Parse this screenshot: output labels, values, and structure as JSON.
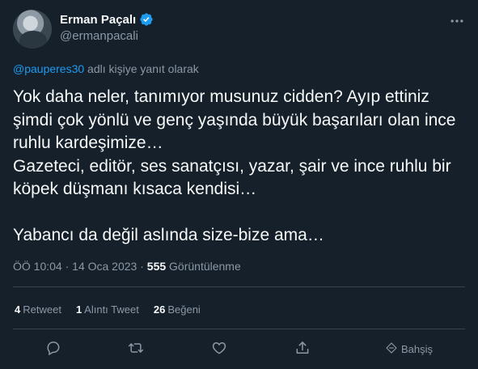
{
  "author": {
    "display_name": "Erman Paçalı",
    "handle": "@ermanpacali",
    "verified": true
  },
  "reply_context": {
    "mention": "@pauperes30",
    "text": " adlı kişiye yanıt olarak"
  },
  "tweet": {
    "text": "Yok daha neler, tanımıyor musunuz cidden? Ayıp ettiniz şimdi çok yönlü ve genç yaşında büyük başarıları olan ince ruhlu kardeşimize…\nGazeteci, editör, ses sanatçısı, yazar, şair ve ince ruhlu bir köpek düşmanı kısaca kendisi…\n\nYabancı da değil aslında size-bize ama…"
  },
  "meta": {
    "time": "ÖÖ 10:04",
    "separator1": " · ",
    "date": "14 Oca 2023",
    "separator2": " · ",
    "views_count": "555",
    "views_label": " Görüntülenme"
  },
  "stats": {
    "retweets_count": "4",
    "retweets_label": "Retweet",
    "quotes_count": "1",
    "quotes_label": "Alıntı Tweet",
    "likes_count": "26",
    "likes_label": "Beğeni"
  },
  "actions": {
    "tip_label": "Bahşiş"
  },
  "icons": {
    "verified": "verified-badge-icon",
    "more": "more-dots-icon",
    "reply": "reply-icon",
    "retweet": "retweet-icon",
    "like": "like-icon",
    "share": "share-icon",
    "tip": "tip-icon"
  },
  "colors": {
    "background": "#15202b",
    "text": "#f7f9f9",
    "secondary": "#8b98a5",
    "accent": "#1d9bf0",
    "divider": "#38444d"
  }
}
